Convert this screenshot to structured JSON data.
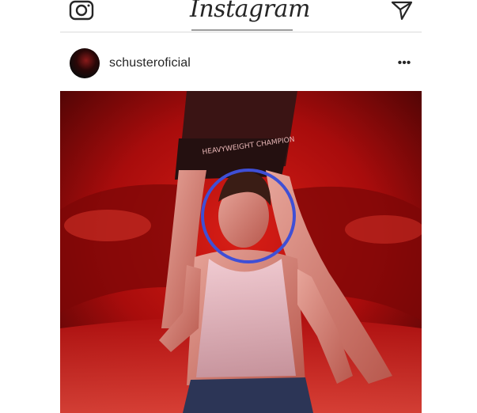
{
  "header": {
    "logo_text": "Instagram"
  },
  "post": {
    "username": "schusteroficial",
    "more_label": "•••",
    "photo_shirt_text": "HEAVYWEIGHT CHAMPION"
  },
  "colors": {
    "annotation_circle": "#3f4fd6",
    "photo_red": "#c81414"
  },
  "icons": {
    "camera": "camera-icon",
    "send": "send-icon",
    "more": "more-options-icon"
  }
}
